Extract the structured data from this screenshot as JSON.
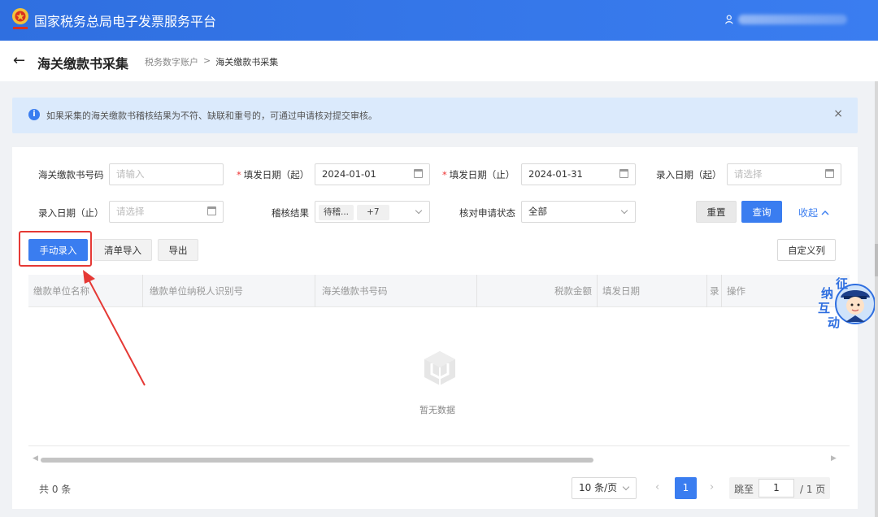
{
  "header": {
    "platform_title": "国家税务总局电子发票服务平台",
    "user_icon": "person-icon"
  },
  "subheader": {
    "back_icon": "←",
    "page_title": "海关缴款书采集",
    "breadcrumb": [
      "税务数字账户",
      "海关缴款书采集"
    ],
    "breadcrumb_sep": ">"
  },
  "notice": {
    "icon": "i",
    "text": "如果采集的海关缴款书稽核结果为不符、缺联和重号的，可通过申请核对提交审核。",
    "close": "×"
  },
  "filters": {
    "customs_no": {
      "label": "海关缴款书号码",
      "placeholder": "请输入"
    },
    "issue_start": {
      "label": "填发日期（起）",
      "value": "2024-01-01"
    },
    "issue_end": {
      "label": "填发日期（止）",
      "value": "2024-01-31"
    },
    "entry_start": {
      "label": "录入日期（起）",
      "placeholder": "请选择"
    },
    "entry_end": {
      "label": "录入日期（止）",
      "placeholder": "请选择"
    },
    "audit_result": {
      "label": "稽核结果",
      "tag": "待稽...",
      "more": "+7"
    },
    "verify_status": {
      "label": "核对申请状态",
      "value": "全部"
    },
    "reset": "重置",
    "query": "查询",
    "collapse": "收起",
    "required_mark": "*"
  },
  "toolbar": {
    "manual_entry": "手动录入",
    "list_import": "清单导入",
    "export": "导出",
    "custom_columns": "自定义列"
  },
  "table": {
    "columns": [
      "缴款单位名称",
      "缴款单位纳税人识别号",
      "海关缴款书号码",
      "税款金额",
      "填发日期",
      "录",
      "操作"
    ],
    "empty_text": "暂无数据"
  },
  "pagination": {
    "total": "共 0 条",
    "page_size": "10 条/页",
    "prev": "‹",
    "next": "›",
    "current": "1",
    "jump_label": "跳至",
    "jump_value": "1",
    "total_pages": "/ 1 页"
  },
  "mascot": {
    "text": [
      "征",
      "纳",
      "互",
      "动"
    ]
  },
  "colors": {
    "primary": "#3a7df0",
    "notice_bg": "#dbeafc",
    "highlight": "#e53935"
  }
}
